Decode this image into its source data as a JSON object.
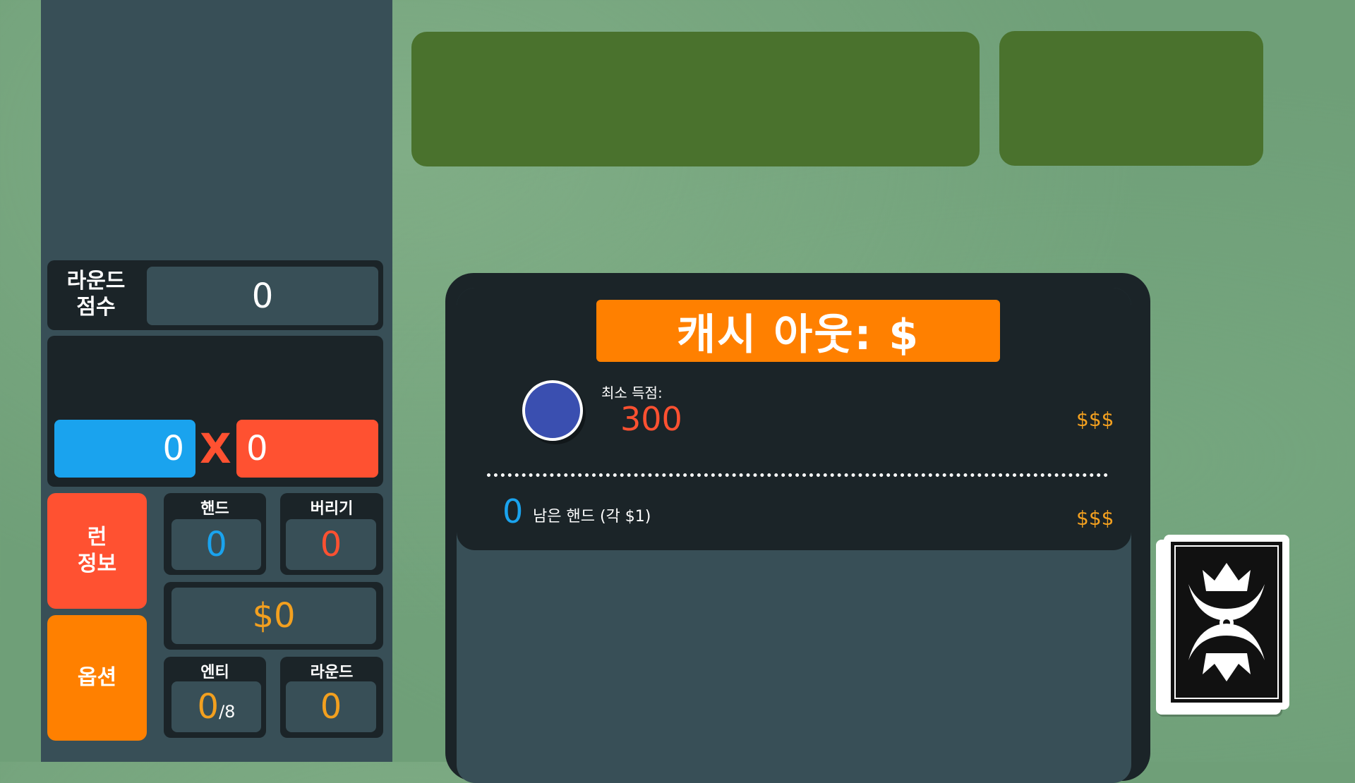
{
  "sidebar": {
    "round_score": {
      "label_line1": "라운드",
      "label_line2": "점수",
      "value": "0"
    },
    "chips": {
      "value": "0",
      "multiplier_sign": "X",
      "mult": "0"
    },
    "run_info_button": {
      "line1": "런",
      "line2": "정보"
    },
    "options_button": {
      "label": "옵션"
    },
    "hands": {
      "label": "핸드",
      "value": "0"
    },
    "discards": {
      "label": "버리기",
      "value": "0"
    },
    "money": {
      "value": "$0"
    },
    "ante": {
      "label": "엔티",
      "value": "0",
      "total": "/8"
    },
    "round": {
      "label": "라운드",
      "value": "0"
    }
  },
  "cashout": {
    "title": "캐시 아웃:  $",
    "min_score_label": "최소 득점:",
    "min_score_value": "300",
    "blind_reward": "$$$",
    "remaining_hands_count": "0",
    "remaining_hands_label": "남은 핸드 (각 $1)",
    "hands_reward": "$$$"
  },
  "colors": {
    "chips_blue": "#1aa3ee",
    "mult_red": "#ff5131",
    "orange": "#ff8000",
    "gold_text": "#f3a01f",
    "panel_dark": "#1b2428",
    "panel_slate": "#384f57",
    "top_green": "#4a722d"
  },
  "icons": {
    "blind_chip": "blue-blind-chip-icon",
    "deck": "card-deck-back-icon"
  }
}
